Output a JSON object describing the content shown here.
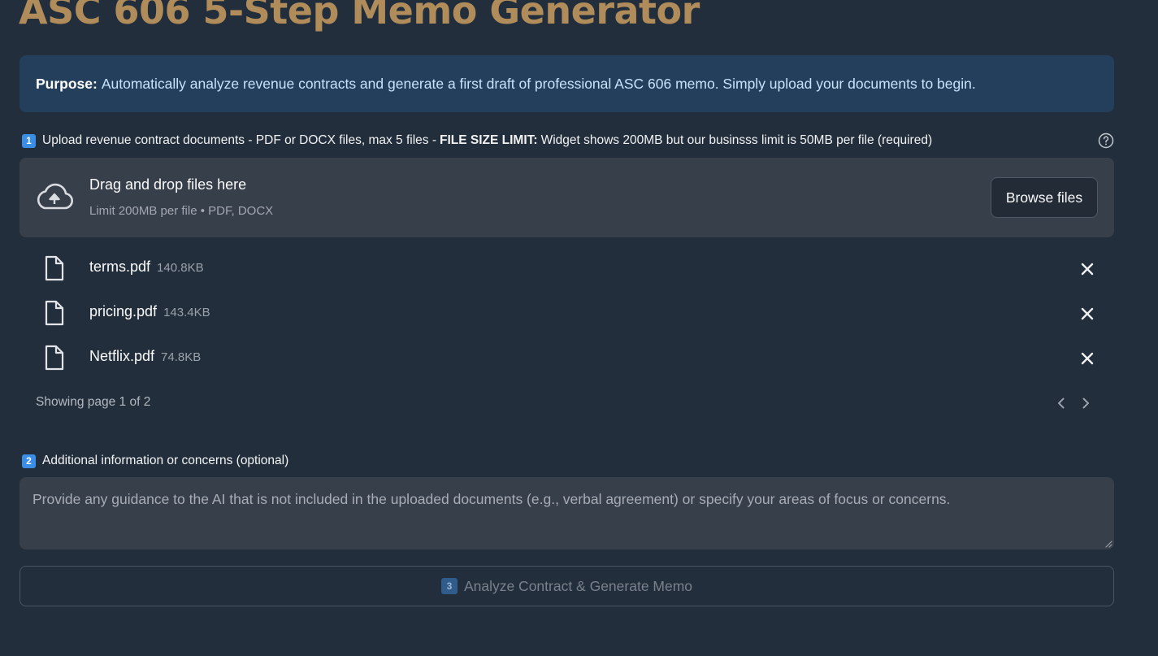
{
  "page": {
    "title": "ASC 606 5-Step Memo Generator"
  },
  "purpose": {
    "label": "Purpose:",
    "text": "Automatically analyze revenue contracts and generate a first draft of professional ASC 606 memo. Simply upload your documents to begin."
  },
  "upload": {
    "step_number": "1",
    "label_prefix": "Upload revenue contract documents - PDF or DOCX files, max 5 files -",
    "label_bold": "FILE SIZE LIMIT:",
    "label_suffix": "Widget shows 200MB but our businsss limit is 50MB per file (required)",
    "help_icon": "question-circle-icon",
    "dropzone_title": "Drag and drop files here",
    "dropzone_subtitle": "Limit 200MB per file • PDF, DOCX",
    "browse_label": "Browse files",
    "files": [
      {
        "name": "terms.pdf",
        "size": "140.8KB"
      },
      {
        "name": "pricing.pdf",
        "size": "143.4KB"
      },
      {
        "name": "Netflix.pdf",
        "size": "74.8KB"
      }
    ],
    "pager_text": "Showing page 1 of 2"
  },
  "additional": {
    "step_number": "2",
    "label": "Additional information or concerns (optional)",
    "placeholder": "Provide any guidance to the AI that is not included in the uploaded documents (e.g., verbal agreement) or specify your areas of focus or concerns."
  },
  "analyze": {
    "step_number": "3",
    "label": "Analyze Contract & Generate Memo"
  },
  "colors": {
    "background": "#222e3c",
    "title": "#b08c5a",
    "purpose_bg": "#243f5b",
    "panel_bg": "#373f4b",
    "badge": "#3a8ee6"
  }
}
